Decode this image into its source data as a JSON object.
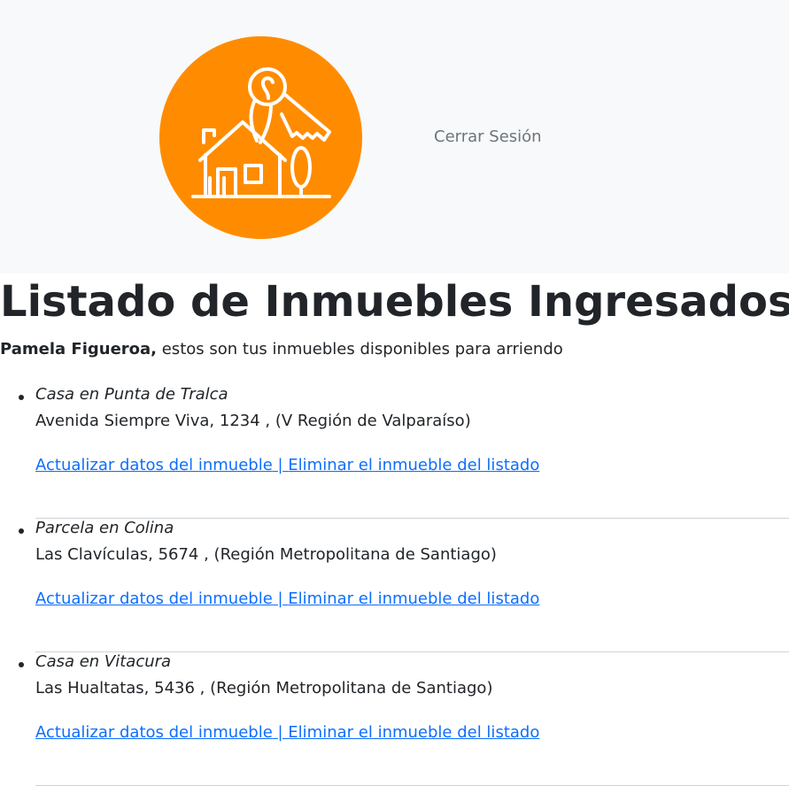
{
  "header": {
    "logo_icon": "house-with-key-icon",
    "logo_color": "#ff8c00",
    "logout_label": "Cerrar Sesión"
  },
  "main": {
    "title": "Listado de Inmuebles Ingresados",
    "intro": {
      "user_name": "Pamela Figueroa,",
      "message": " estos son tus inmuebles disponibles para arriendo"
    },
    "listings": [
      {
        "name": "Casa en Punta de Tralca",
        "address": "Avenida Siempre Viva, 1234 , (V Región de Valparaíso)",
        "update_label": "Actualizar datos del inmueble",
        "separator": " | ",
        "delete_label": "Eliminar el inmueble del listado"
      },
      {
        "name": "Parcela en Colina",
        "address": "Las Clavículas, 5674 , (Región Metropolitana de Santiago)",
        "update_label": "Actualizar datos del inmueble",
        "separator": " | ",
        "delete_label": "Eliminar el inmueble del listado"
      },
      {
        "name": "Casa en Vitacura",
        "address": "Las Hualtatas, 5436 , (Región Metropolitana de Santiago)",
        "update_label": "Actualizar datos del inmueble",
        "separator": " | ",
        "delete_label": "Eliminar el inmueble del listado"
      }
    ]
  },
  "colors": {
    "header_bg": "#f8f9fa",
    "link": "#0d6efd",
    "muted": "#6c757d"
  }
}
